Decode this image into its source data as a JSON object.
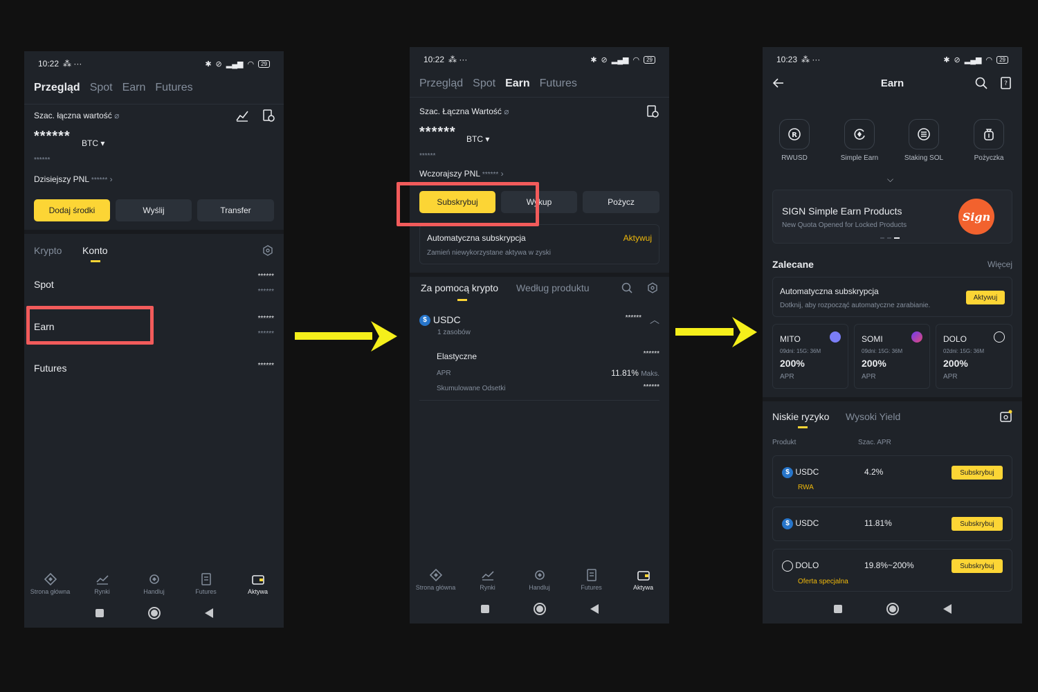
{
  "status1": {
    "time": "10:22",
    "battery": "29"
  },
  "status2": {
    "time": "10:22",
    "battery": "29"
  },
  "status3": {
    "time": "10:23",
    "battery": "29"
  },
  "phone1": {
    "tabs": [
      "Przegląd",
      "Spot",
      "Earn",
      "Futures"
    ],
    "total_label": "Szac. łączna wartość",
    "balance_masked": "******",
    "currency": "BTC",
    "sub_masked": "******",
    "pnl_label": "Dzisiejszy PNL",
    "pnl_masked": "******",
    "buttons": [
      "Dodaj środki",
      "Wyślij",
      "Transfer"
    ],
    "subtabs": [
      "Krypto",
      "Konto"
    ],
    "accounts": [
      {
        "name": "Spot",
        "value": "******",
        "sub": "******"
      },
      {
        "name": "Earn",
        "value": "******",
        "sub": "******"
      },
      {
        "name": "Futures",
        "value": "******"
      }
    ]
  },
  "phone2": {
    "tabs": [
      "Przegląd",
      "Spot",
      "Earn",
      "Futures"
    ],
    "total_label": "Szac. Łączna Wartość",
    "balance_masked": "******",
    "currency": "BTC",
    "sub_masked": "******",
    "pnl_label": "Wczorajszy PNL",
    "pnl_masked": "******",
    "buttons": [
      "Subskrybuj",
      "Wykup",
      "Pożycz"
    ],
    "auto_title": "Automatyczna subskrypcja",
    "auto_desc": "Zamień niewykorzystane aktywa w zyski",
    "auto_action": "Aktywuj",
    "subtabs": [
      "Za pomocą krypto",
      "Według produktu"
    ],
    "asset": {
      "name": "USDC",
      "count": "1 zasobów",
      "value": "******"
    },
    "product": {
      "name": "Elastyczne",
      "value": "******",
      "apr_label": "APR",
      "apr": "11.81%",
      "apr_suffix": "Maks.",
      "interest_label": "Skumulowane Odsetki",
      "interest": "******"
    }
  },
  "phone3": {
    "title": "Earn",
    "shortcuts": [
      "RWUSD",
      "Simple Earn",
      "Staking SOL",
      "Pożyczka"
    ],
    "banner": {
      "title": "SIGN Simple Earn Products",
      "subtitle": "New Quota Opened for Locked Products",
      "logo": "Sign"
    },
    "section": "Zalecane",
    "more": "Więcej",
    "auto": {
      "title": "Automatyczna subskrypcja",
      "desc": "Dotknij, aby rozpocząć automatyczne zarabianie.",
      "action": "Aktywuj"
    },
    "tokens": [
      {
        "name": "MITO",
        "meta": "09dni: 15G: 36M",
        "apr": "200%",
        "label": "APR"
      },
      {
        "name": "SOMI",
        "meta": "09dni: 15G: 36M",
        "apr": "200%",
        "label": "APR"
      },
      {
        "name": "DOLO",
        "meta": "02dni: 15G: 36M",
        "apr": "200%",
        "label": "APR"
      }
    ],
    "risk_tabs": [
      "Niskie ryzyko",
      "Wysoki Yield"
    ],
    "col_product": "Produkt",
    "col_apr": "Szac. APR",
    "products": [
      {
        "name": "USDC",
        "apr": "4.2%",
        "tag": "RWA",
        "action": "Subskrybuj"
      },
      {
        "name": "USDC",
        "apr": "11.81%",
        "tag": "",
        "action": "Subskrybuj"
      },
      {
        "name": "DOLO",
        "apr": "19.8%~200%",
        "tag": "Oferta specjalna",
        "action": "Subskrybuj"
      }
    ]
  },
  "nav": [
    "Strona główna",
    "Rynki",
    "Handluj",
    "Futures",
    "Aktywa"
  ],
  "colors": {
    "accent": "#fcd535",
    "highlight": "#f25b5b",
    "arrow": "#f5ef1b",
    "panel": "#1f2329"
  }
}
